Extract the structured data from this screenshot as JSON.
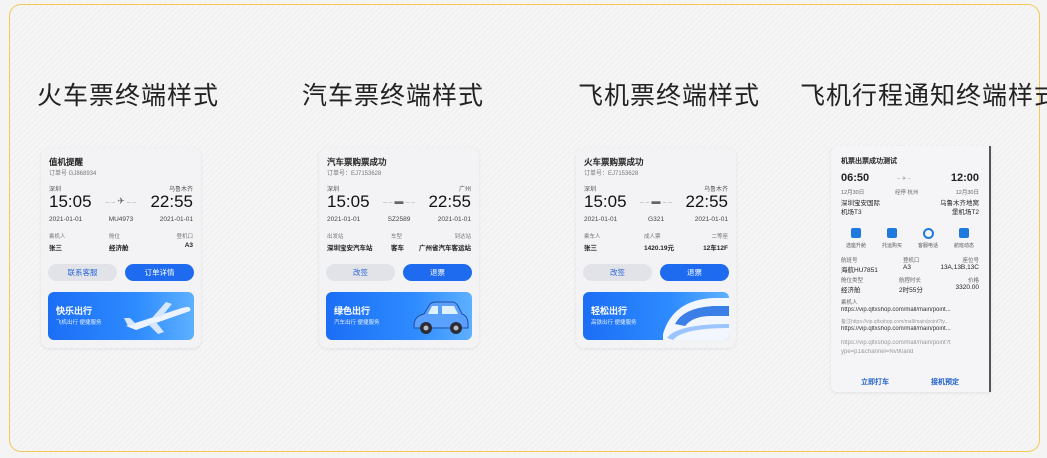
{
  "sections": [
    {
      "title": "火车票终端样式"
    },
    {
      "title": "汽车票终端样式"
    },
    {
      "title": "飞机票终端样式"
    },
    {
      "title": "飞机行程通知终端样式"
    }
  ],
  "cards": [
    {
      "title": "值机提醒",
      "order": "订单号 GJ868934",
      "from_city": "深圳",
      "to_city": "乌鲁木齐",
      "depart_time": "15:05",
      "arrive_time": "22:55",
      "depart_date": "2021-01-01",
      "code": "MU4973",
      "arrive_date": "2021-01-01",
      "route_icon": "✈",
      "labels": [
        "乘机人",
        "舱位",
        "登机口"
      ],
      "values": [
        "张三",
        "经济舱",
        "A3"
      ],
      "btn_left": "联系客服",
      "btn_right": "订单详情",
      "banner_title": "快乐出行",
      "banner_sub": "飞机出行 便捷服务"
    },
    {
      "title": "汽车票购票成功",
      "order": "订单号：EJ7153628",
      "from_city": "深圳",
      "to_city": "广州",
      "depart_time": "15:05",
      "arrive_time": "22:55",
      "depart_date": "2021-01-01",
      "code": "SZ2589",
      "arrive_date": "2021-01-01",
      "route_icon": "▬",
      "labels": [
        "出发站",
        "车型",
        "到达站"
      ],
      "values": [
        "深圳宝安汽车站",
        "客车",
        "广州省汽车客运站"
      ],
      "btn_left": "改签",
      "btn_right": "退票",
      "banner_title": "绿色出行",
      "banner_sub": "汽车出行 便捷服务"
    },
    {
      "title": "火车票购票成功",
      "order": "订单号：EJ7153628",
      "from_city": "深圳",
      "to_city": "乌鲁木齐",
      "depart_time": "15:05",
      "arrive_time": "22:55",
      "depart_date": "2021-01-01",
      "code": "G321",
      "arrive_date": "2021-01-01",
      "route_icon": "▬",
      "labels": [
        "乘车人",
        "成人票",
        "二等座"
      ],
      "values": [
        "张三",
        "1420.19元",
        "12车12F"
      ],
      "btn_left": "改签",
      "btn_right": "退票",
      "banner_title": "轻松出行",
      "banner_sub": "高铁出行 便捷服务"
    }
  ],
  "notice": {
    "title": "机票出票成功测试",
    "depart_time": "06:50",
    "arrive_time": "12:00",
    "depart_date": "12月30日",
    "duration": "经停 杭州",
    "arrive_date": "12月30日",
    "from_airport_1": "深圳宝安国际",
    "from_airport_2": "机场T3",
    "to_airport_1": "乌鲁木齐地窝",
    "to_airport_2": "堡机场T2",
    "icons": [
      {
        "name": "car",
        "label": "选座升舱"
      },
      {
        "name": "gift",
        "label": "托运购买"
      },
      {
        "name": "headset",
        "label": "客服电话"
      },
      {
        "name": "calendar",
        "label": "航班动态"
      }
    ],
    "row1_labels": [
      "航班号",
      "登机口",
      "座位号"
    ],
    "row1_values": [
      "海航HU7851",
      "A3",
      "13A,13B,13C"
    ],
    "row2_labels": [
      "舱位类型",
      "航程时长",
      "价格"
    ],
    "row2_values": [
      "经济舱",
      "2时55分",
      "3320.00"
    ],
    "passenger_label": "乘机人",
    "link1": "https://vip.qltxshop.com/mall/main/point...",
    "link2_grey": "备注https://vip.qltxshop.com/mall/main/point?ty...",
    "link3": "https://vip.qltxshop.com/mall/main/point...",
    "link4a": "https://vip.qltxshop.com/mall/main/point?t",
    "link4b": "ype=p1&channel=Nv90and",
    "btn_left": "立即打车",
    "btn_right": "接机预定"
  }
}
